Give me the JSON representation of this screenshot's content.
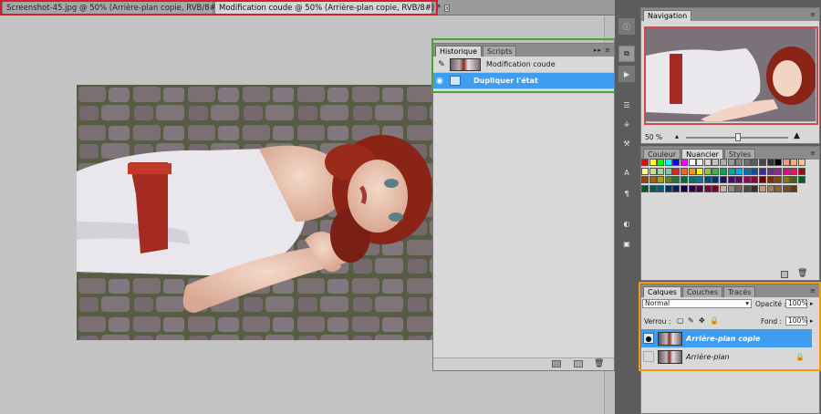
{
  "document_tabs": [
    {
      "label": "Screenshot-45.jpg @ 50% (Arrière-plan copie, RVB/8#)  *",
      "close": "x"
    },
    {
      "label": "Modification coude @ 50% (Arrière-plan copie, RVB/8#)  *",
      "close": "x"
    }
  ],
  "history_panel": {
    "tabs": [
      "Historique",
      "Scripts"
    ],
    "menu_icon": "panel-menu-icon",
    "items": [
      {
        "label": "Modification coude",
        "selected": false
      },
      {
        "label": "Dupliquer l'état",
        "selected": true
      }
    ]
  },
  "navigator": {
    "title": "Navigation",
    "zoom": "50 %"
  },
  "color_panel": {
    "tabs": [
      "Couleur",
      "Nuancier",
      "Styles"
    ],
    "active": "Nuancier"
  },
  "layers_panel": {
    "tabs": [
      "Calques",
      "Couches",
      "Tracés"
    ],
    "blend_mode": "Normal",
    "opacity_label": "Opacité :",
    "opacity_value": "100%",
    "lock_label": "Verrou :",
    "fill_label": "Fond :",
    "fill_value": "100%",
    "layers": [
      {
        "name": "Arrière-plan copie",
        "visible": true,
        "selected": true
      },
      {
        "name": "Arrière-plan",
        "visible": false,
        "selected": false,
        "locked": true
      }
    ]
  },
  "colors": {
    "highlight_tabs": "#d0202c",
    "highlight_history": "#48a431",
    "highlight_navigator": "#d24a4a",
    "highlight_layers": "#f09a1a",
    "selection_blue": "#3f9df0"
  }
}
